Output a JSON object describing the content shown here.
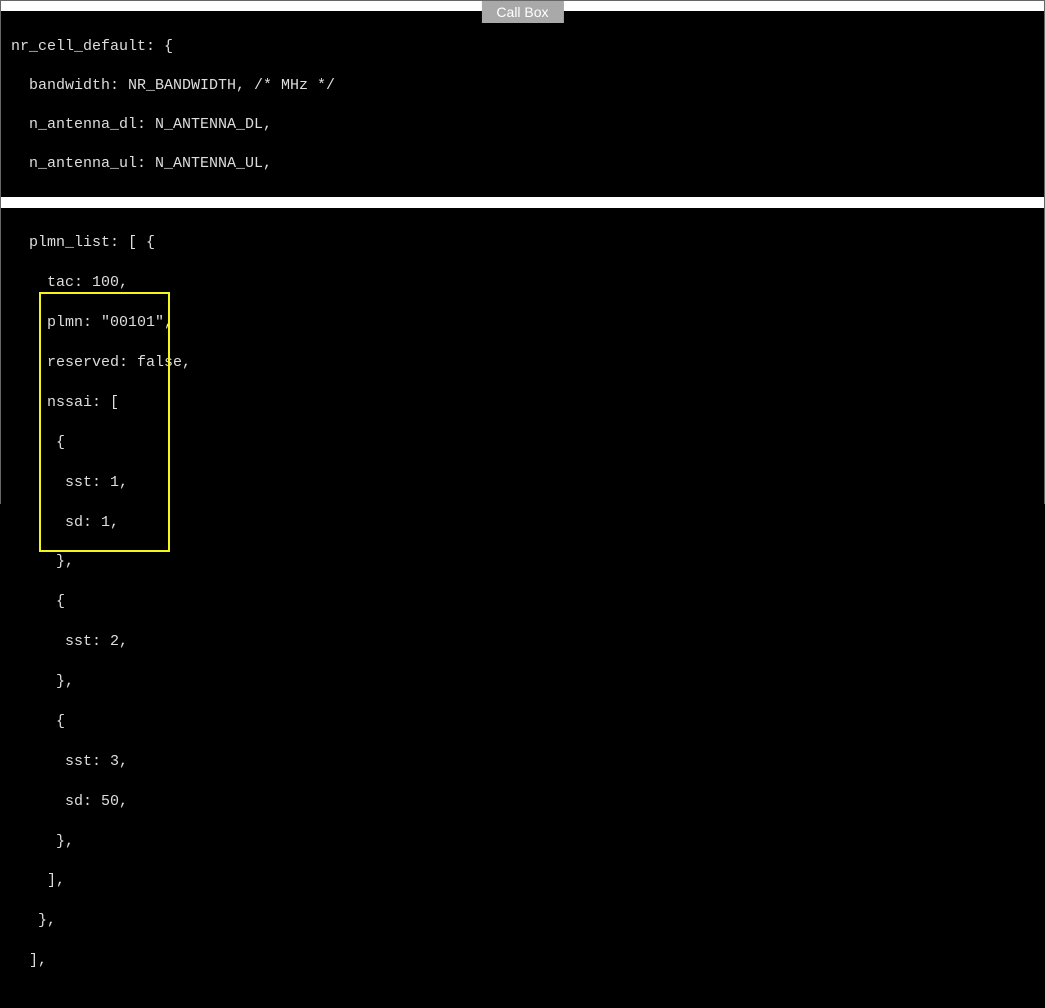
{
  "tab": {
    "label": "Call Box"
  },
  "block1": {
    "line1": "nr_cell_default: {",
    "line2": "  bandwidth: NR_BANDWIDTH, /* MHz */",
    "line3": "  n_antenna_dl: N_ANTENNA_DL,",
    "line4": "  n_antenna_ul: N_ANTENNA_UL,"
  },
  "block2": {
    "line1": "  plmn_list: [ {",
    "line2": "    tac: 100,",
    "line3": "    plmn: \"00101\",",
    "line4": "    reserved: false,",
    "line5": "    nssai: [",
    "line6": "     {",
    "line7": "      sst: 1,",
    "line8": "      sd: 1,",
    "line9": "     },",
    "line10": "     {",
    "line11": "      sst: 2,",
    "line12": "     },",
    "line13": "     {",
    "line14": "      sst: 3,",
    "line15": "      sd: 50,",
    "line16": "     },",
    "line17": "    ],",
    "line18": "   },",
    "line19": "  ],"
  }
}
